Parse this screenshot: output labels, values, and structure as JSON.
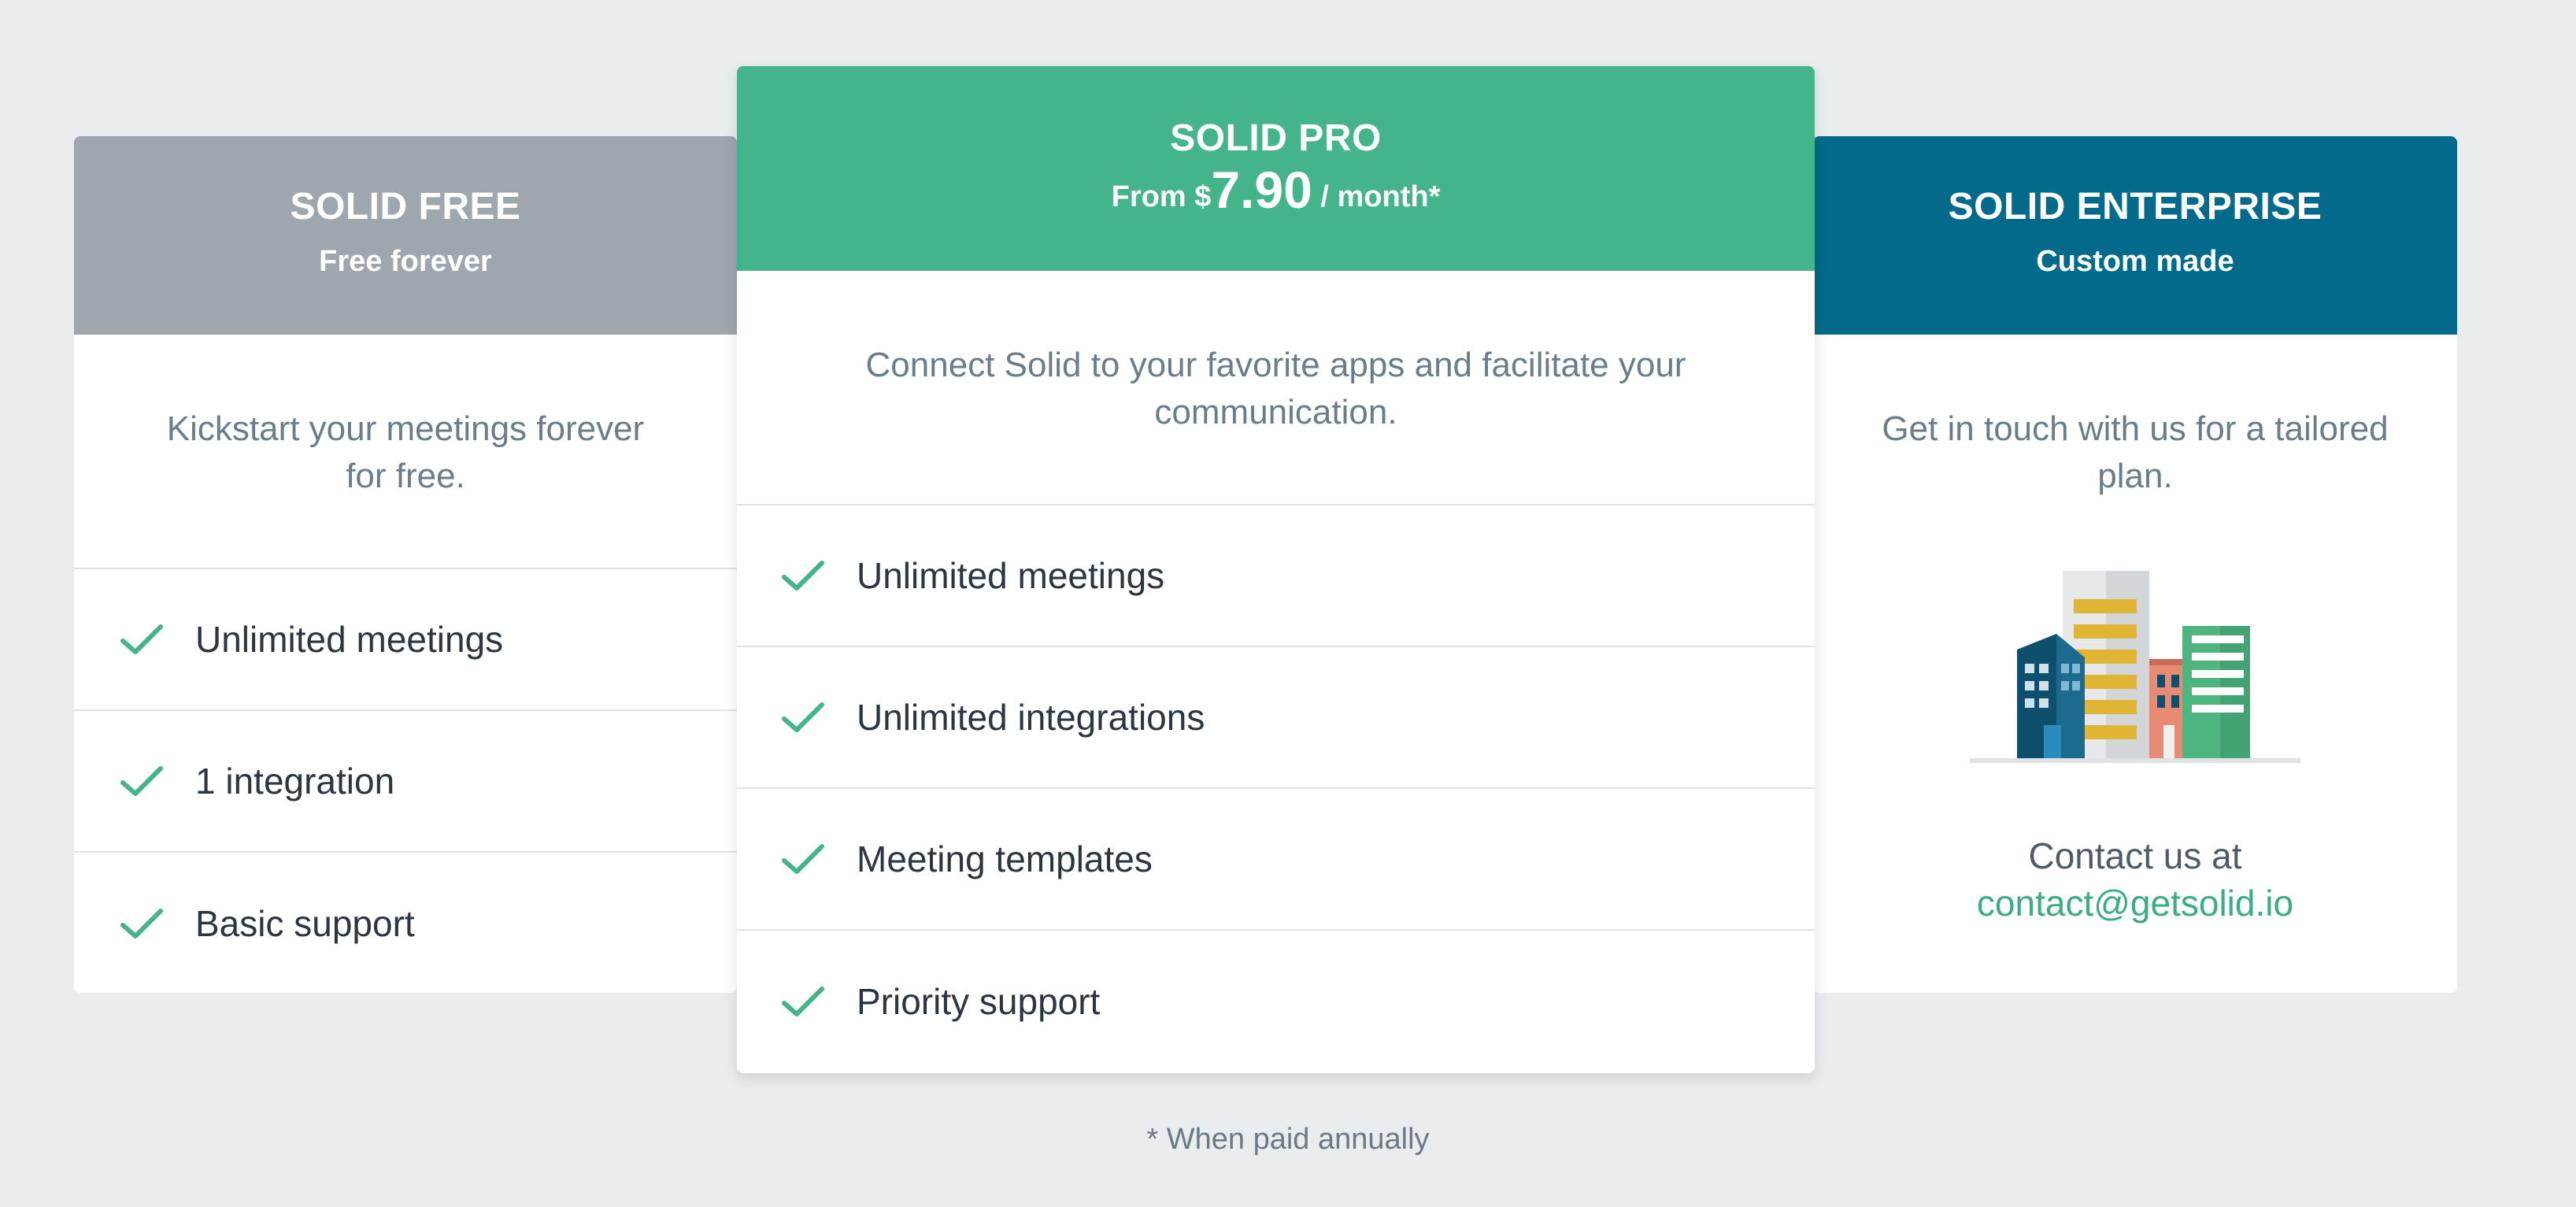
{
  "plans": {
    "free": {
      "name": "SOLID FREE",
      "subtitle": "Free forever",
      "description": "Kickstart your meetings forever for free.",
      "features": [
        "Unlimited meetings",
        "1 integration",
        "Basic support"
      ]
    },
    "pro": {
      "name": "SOLID PRO",
      "price_prefix": "From $",
      "price_amount": "7.90",
      "price_suffix": " / month*",
      "description": "Connect Solid to your favorite apps and facilitate your communication.",
      "features": [
        "Unlimited meetings",
        "Unlimited integrations",
        "Meeting templates",
        "Priority support"
      ]
    },
    "enterprise": {
      "name": "SOLID ENTERPRISE",
      "subtitle": "Custom made",
      "description": "Get in touch with us for a tailored plan.",
      "contact_text": "Contact us at",
      "contact_email": "contact@getsolid.io",
      "icon": "city-buildings-icon"
    }
  },
  "footnote": "* When paid annually",
  "colors": {
    "background": "#e9edee",
    "free_header": "#9ea7ad",
    "pro_header": "#44b48a",
    "enterprise_header": "#036a8b",
    "accent_green": "#3aad84",
    "check_icon": "#44b48a"
  },
  "icons": {
    "check": "check-icon"
  }
}
